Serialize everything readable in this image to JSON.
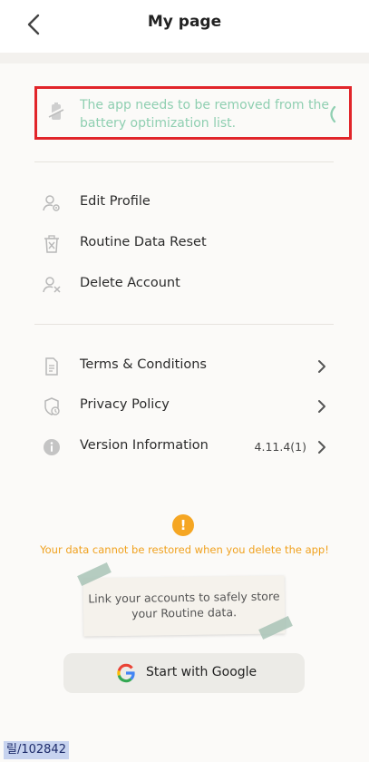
{
  "header": {
    "title": "My page",
    "back_icon": "chevron-left-icon"
  },
  "notice": {
    "text": "The app needs to be removed from the battery optimization list.",
    "icon": "battery-optimization-icon",
    "border_color": "#e1252a",
    "text_color": "#8fcfb1"
  },
  "account_menu": [
    {
      "label": "Edit Profile",
      "icon": "user-gear-icon"
    },
    {
      "label": "Routine Data Reset",
      "icon": "trash-reset-icon"
    },
    {
      "label": "Delete Account",
      "icon": "user-remove-icon"
    }
  ],
  "info_menu": [
    {
      "label": "Terms & Conditions",
      "icon": "document-icon"
    },
    {
      "label": "Privacy Policy",
      "icon": "shield-lock-icon"
    },
    {
      "label": "Version Information",
      "icon": "info-icon",
      "value": "4.11.4(1)"
    }
  ],
  "warning": {
    "icon": "exclamation-icon",
    "text": "Your data cannot be restored when you delete the app!",
    "color": "#f0a11e"
  },
  "note": {
    "line1": "Link your accounts to safely store",
    "line2": "your Routine data."
  },
  "google_button": {
    "label": "Start with Google",
    "icon": "google-g-icon"
  },
  "footer": {
    "id": "릴/102842"
  }
}
